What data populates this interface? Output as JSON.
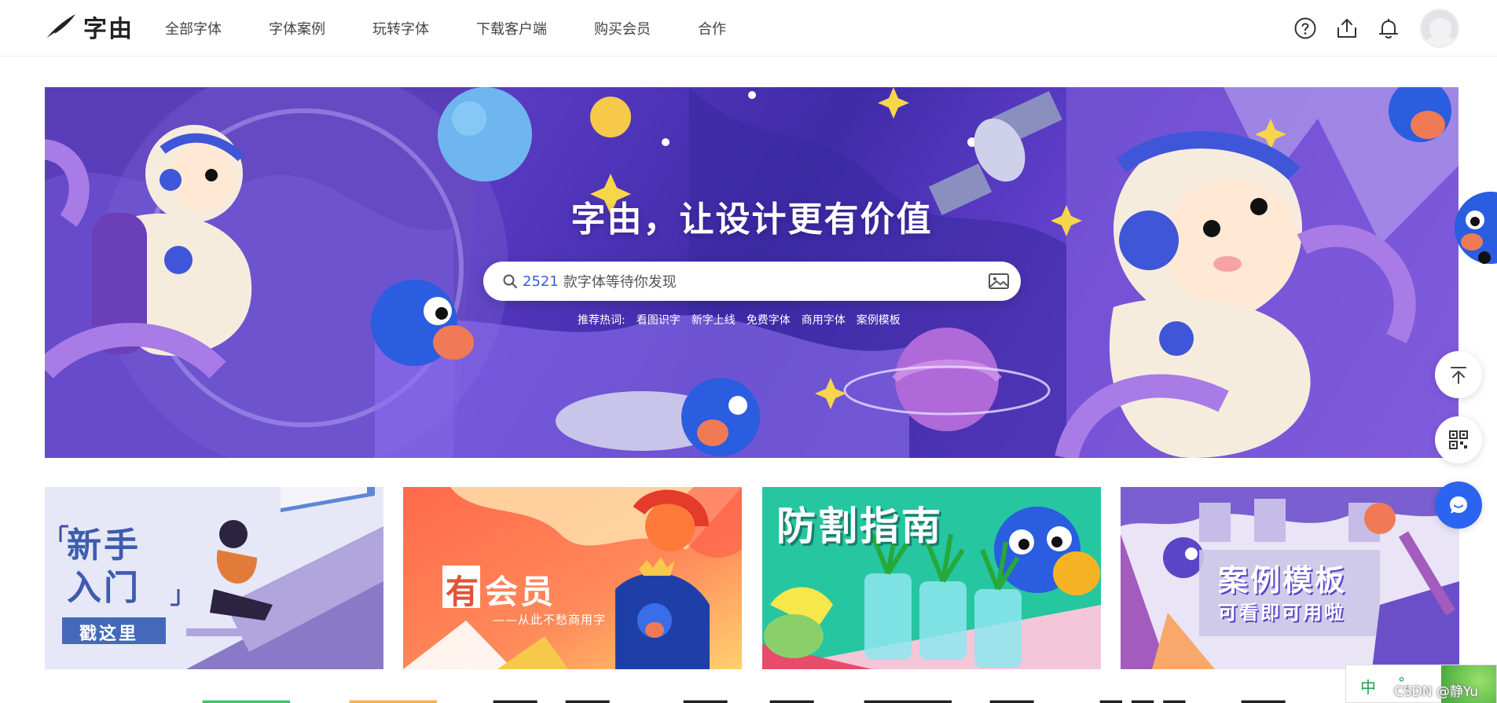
{
  "header": {
    "logo_text": "字由",
    "nav": [
      {
        "label": "全部字体"
      },
      {
        "label": "字体案例"
      },
      {
        "label": "玩转字体"
      },
      {
        "label": "下载客户端"
      },
      {
        "label": "购买会员"
      },
      {
        "label": "合作"
      }
    ],
    "icons": [
      "help-icon",
      "upload-icon",
      "bell-icon",
      "avatar"
    ]
  },
  "banner": {
    "title": "字由，让设计更有价值",
    "search": {
      "count": "2521",
      "placeholder": "款字体等待你发现"
    },
    "hot_label": "推荐热词:",
    "hot_words": [
      "看图识字",
      "新字上线",
      "免费字体",
      "商用字体",
      "案例模板"
    ]
  },
  "cards": [
    {
      "title_line1": "新手",
      "title_line2": "入门",
      "button": "戳这里"
    },
    {
      "title_mark": "有",
      "title_rest": "会员",
      "subtitle": "——从此不愁商用字"
    },
    {
      "title": "防割指南"
    },
    {
      "title": "案例模板",
      "subtitle": "可看即可用啦"
    }
  ],
  "side_buttons": [
    "back-to-top-icon",
    "qr-code-icon",
    "chat-icon"
  ],
  "ime": {
    "lang": "中",
    "punct": "°,"
  },
  "watermark": "CSDN @静Yu",
  "colors": {
    "brand_blue": "#2a64f0",
    "banner_purple": "#5b3bc4",
    "search_count": "#3b5bdb"
  }
}
